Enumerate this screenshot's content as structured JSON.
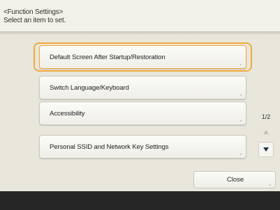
{
  "header": {
    "title": "<Function Settings>",
    "subtitle": "Select an item to set."
  },
  "items": [
    {
      "label": "Default Screen After Startup/Restoration",
      "selected": true
    },
    {
      "label": "Switch Language/Keyboard",
      "selected": false
    },
    {
      "label": "Accessibility",
      "selected": false
    },
    {
      "label": "Personal SSID and Network Key Settings",
      "selected": false
    }
  ],
  "pager": {
    "page_indicator": "1/2",
    "up_icon": "triangle-up-icon",
    "down_icon": "triangle-down-icon"
  },
  "footer_actions": {
    "close_label": "Close"
  },
  "colors": {
    "background": "#e9e7dc",
    "focus_ring": "#f2a93b",
    "footer_bar": "#262626"
  }
}
